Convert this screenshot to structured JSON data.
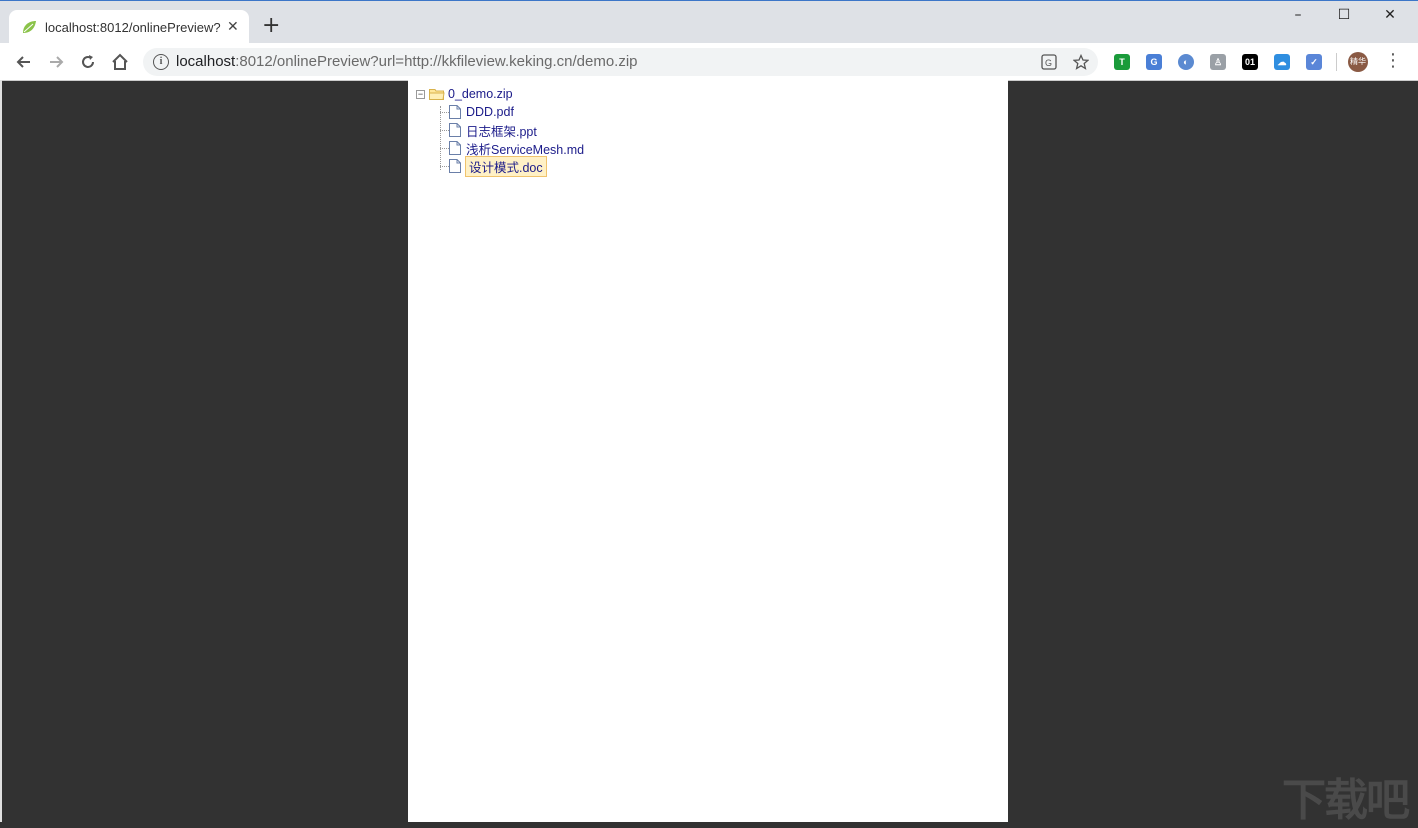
{
  "browser": {
    "tab_title": "localhost:8012/onlinePreview?",
    "tab_close": "✕",
    "new_tab": "+",
    "window_controls": {
      "minimize": "–",
      "maximize": "☐",
      "close": "✕"
    },
    "url_host": "localhost",
    "url_rest": ":8012/onlinePreview?url=http://kkfileview.keking.cn/demo.zip",
    "extensions": [
      {
        "name": "shield-extension-icon",
        "label": "T",
        "color": "#1a9b3a"
      },
      {
        "name": "translate-extension-icon",
        "label": "G",
        "color": "#4a7fd6"
      },
      {
        "name": "circle-extension-icon",
        "label": "◐",
        "color": "#5b8ad1"
      },
      {
        "name": "tree-extension-icon",
        "label": "♙",
        "color": "#9aa0a6"
      },
      {
        "name": "binary-extension-icon",
        "label": "01",
        "color": "#000000"
      },
      {
        "name": "cloud-extension-icon",
        "label": "☁",
        "color": "#2f8ee0"
      },
      {
        "name": "bird-extension-icon",
        "label": "✓",
        "color": "#5a86d8"
      }
    ],
    "avatar_text": "精华"
  },
  "tree": {
    "root": {
      "label": "0_demo.zip",
      "expander": "−"
    },
    "children": [
      {
        "label": "DDD.pdf",
        "selected": false
      },
      {
        "label": "日志框架.ppt",
        "selected": false
      },
      {
        "label": "浅析ServiceMesh.md",
        "selected": false
      },
      {
        "label": "设计模式.doc",
        "selected": true
      }
    ]
  },
  "watermark": "下载吧"
}
